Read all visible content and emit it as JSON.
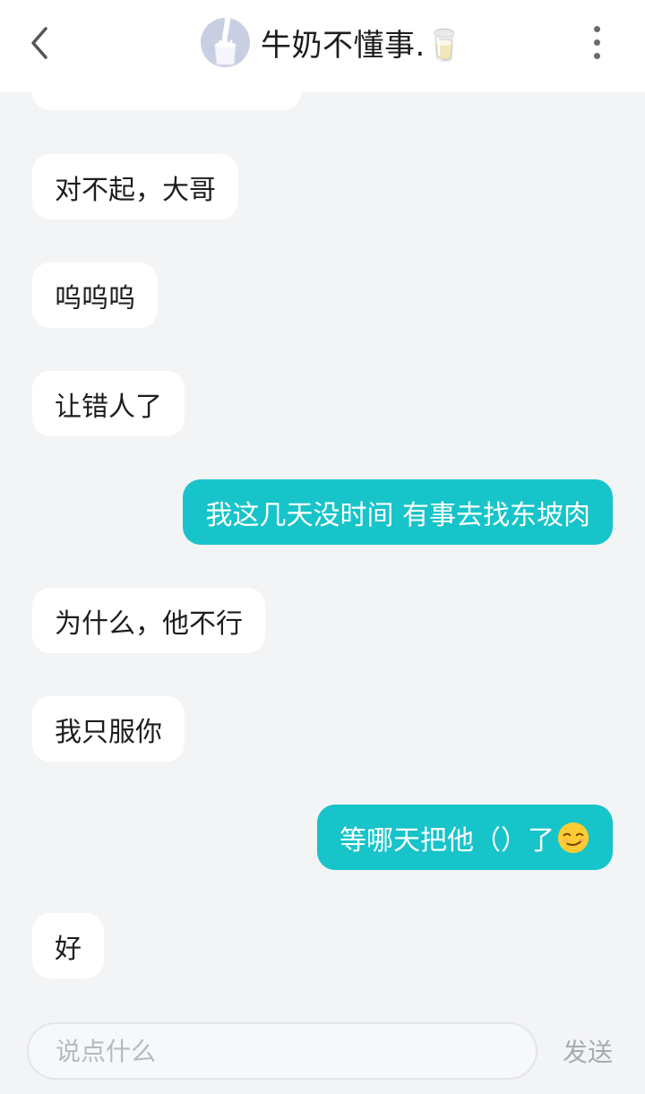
{
  "header": {
    "title": "牛奶不懂事.🥛",
    "back_icon": "chevron-left-icon",
    "more_icon": "more-vertical-icon"
  },
  "messages": [
    {
      "side": "in",
      "text": "对不起，大哥"
    },
    {
      "side": "in",
      "text": "呜呜呜"
    },
    {
      "side": "in",
      "text": "让错人了"
    },
    {
      "side": "out",
      "text": "我这几天没时间 有事去找东坡肉"
    },
    {
      "side": "in",
      "text": "为什么，他不行"
    },
    {
      "side": "in",
      "text": "我只服你"
    },
    {
      "side": "out",
      "text": "等哪天把他（）了",
      "emoji": "smirk-emoji-icon"
    },
    {
      "side": "in",
      "text": "好"
    }
  ],
  "composer": {
    "placeholder": "说点什么",
    "send_label": "发送"
  },
  "colors": {
    "outgoing_bubble": "#17c4ca",
    "incoming_bubble": "#ffffff",
    "background": "#f3f4f6"
  }
}
